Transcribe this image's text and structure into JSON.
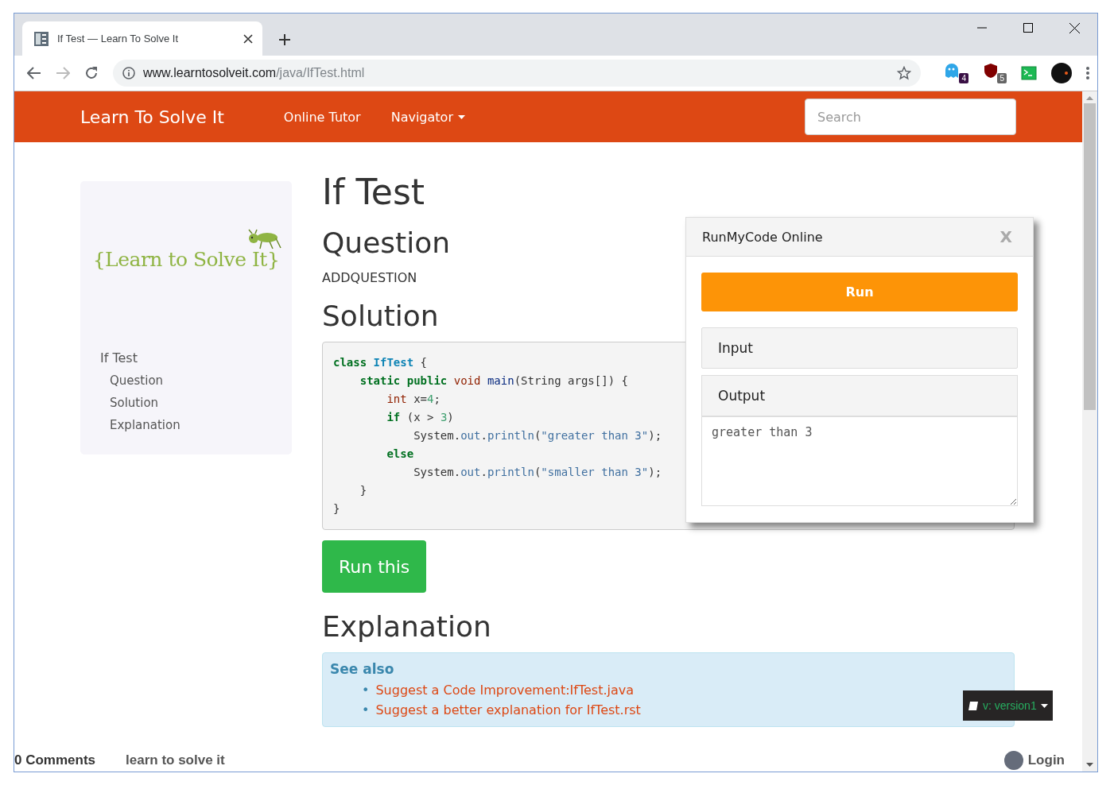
{
  "browser": {
    "tab_title": "If Test — Learn To Solve It",
    "url_host": "www.learntosolveit.com",
    "url_path": "/java/IfTest.html",
    "extension_badges": [
      "4",
      "5"
    ]
  },
  "navbar": {
    "brand": "Learn To Solve It",
    "links": [
      {
        "label": "Online Tutor",
        "dropdown": false
      },
      {
        "label": "Navigator",
        "dropdown": true
      }
    ],
    "search_placeholder": "Search"
  },
  "sidebar": {
    "logo_text": "{Learn to Solve It}",
    "toc": [
      {
        "label": "If Test",
        "children": [
          {
            "label": "Question"
          },
          {
            "label": "Solution"
          },
          {
            "label": "Explanation"
          }
        ]
      }
    ]
  },
  "page": {
    "title": "If Test",
    "question_heading": "Question",
    "question_text": "ADDQUESTION",
    "solution_heading": "Solution",
    "code_lines": [
      [
        {
          "kind": "kw",
          "text": "class"
        },
        {
          "kind": "cls",
          "text": " IfTest"
        },
        {
          "kind": "plain",
          "text": " {"
        }
      ],
      [
        {
          "kind": "kw",
          "text": "    static"
        },
        {
          "kind": "kw",
          "text": " public"
        },
        {
          "kind": "type",
          "text": " void"
        },
        {
          "kind": "fn",
          "text": " main"
        },
        {
          "kind": "plain",
          "text": "(String args[]) {"
        }
      ],
      [
        {
          "kind": "type",
          "text": "        int"
        },
        {
          "kind": "plain",
          "text": " x="
        },
        {
          "kind": "num",
          "text": "4"
        },
        {
          "kind": "plain",
          "text": ";"
        }
      ],
      [
        {
          "kind": "kw",
          "text": "        if"
        },
        {
          "kind": "plain",
          "text": " (x > "
        },
        {
          "kind": "num",
          "text": "3"
        },
        {
          "kind": "plain",
          "text": ")"
        }
      ],
      [
        {
          "kind": "plain",
          "text": "            System."
        },
        {
          "kind": "attr",
          "text": "out"
        },
        {
          "kind": "plain",
          "text": "."
        },
        {
          "kind": "attr",
          "text": "println"
        },
        {
          "kind": "plain",
          "text": "("
        },
        {
          "kind": "str",
          "text": "\"greater than 3\""
        },
        {
          "kind": "plain",
          "text": ");"
        }
      ],
      [
        {
          "kind": "kw",
          "text": "        else"
        }
      ],
      [
        {
          "kind": "plain",
          "text": "            System."
        },
        {
          "kind": "attr",
          "text": "out"
        },
        {
          "kind": "plain",
          "text": "."
        },
        {
          "kind": "attr",
          "text": "println"
        },
        {
          "kind": "plain",
          "text": "("
        },
        {
          "kind": "str",
          "text": "\"smaller than 3\""
        },
        {
          "kind": "plain",
          "text": ");"
        }
      ],
      [
        {
          "kind": "plain",
          "text": "    }"
        }
      ],
      [
        {
          "kind": "plain",
          "text": "}"
        }
      ]
    ],
    "run_button": "Run this",
    "explanation_heading": "Explanation",
    "see_also_title": "See also",
    "see_also_links": [
      {
        "bullet": "•",
        "text": "Suggest a Code Improvement:IfTest.java"
      },
      {
        "bullet": "•",
        "text": "Suggest a better explanation for IfTest.rst"
      }
    ]
  },
  "popup": {
    "title": "RunMyCode Online",
    "close": "X",
    "run_button": "Run",
    "input_label": "Input",
    "output_label": "Output",
    "output_value": "greater than 3"
  },
  "version_badge": "v: version1",
  "comments_bar": {
    "count": "0 Comments",
    "site": "learn to solve it",
    "login": "Login"
  }
}
